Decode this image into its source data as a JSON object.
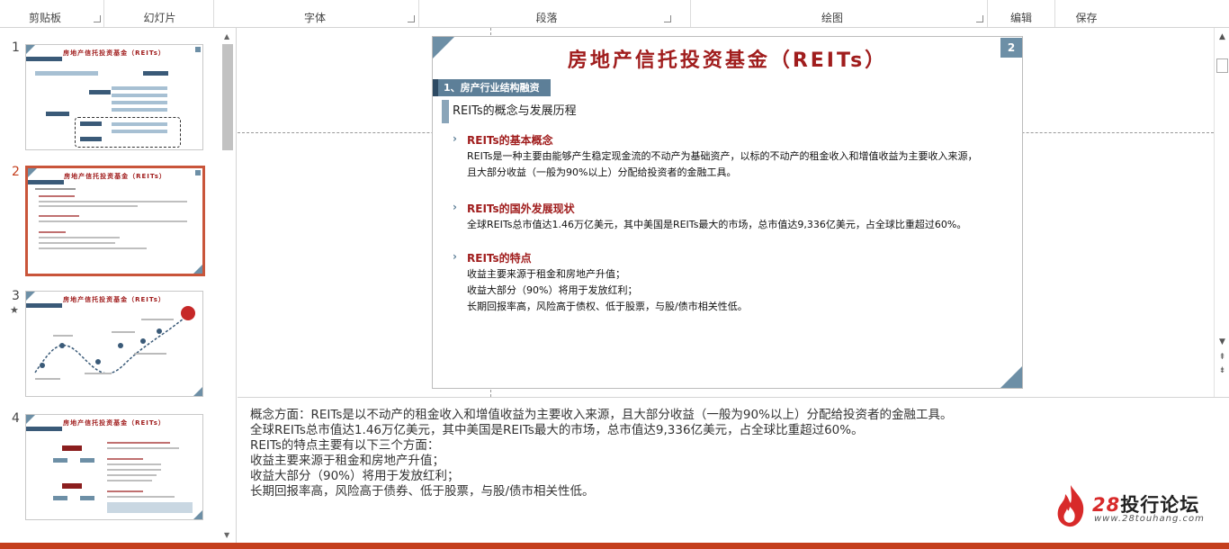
{
  "ribbon": {
    "groups": [
      {
        "label": "剪贴板"
      },
      {
        "label": "幻灯片"
      },
      {
        "label": "字体"
      },
      {
        "label": "段落"
      },
      {
        "label": "绘图"
      },
      {
        "label": "编辑"
      },
      {
        "label": "保存"
      }
    ]
  },
  "thumbnails": [
    {
      "number": "1",
      "title": "房地产信托投资基金（REITs）",
      "starred": false,
      "active": false
    },
    {
      "number": "2",
      "title": "房地产信托投资基金（REITs）",
      "starred": false,
      "active": true
    },
    {
      "number": "3",
      "title": "房地产信托投资基金（REITs）",
      "starred": true,
      "active": false
    },
    {
      "number": "4",
      "title": "房地产信托投资基金（REITs）",
      "starred": false,
      "active": false
    }
  ],
  "slide": {
    "number": "2",
    "title": "房地产信托投资基金（REITs）",
    "section": "1、房产行业结构融资",
    "subtitle": "REITs的概念与发展历程",
    "blocks": [
      {
        "heading": "REITs的基本概念",
        "lines": [
          "REITs是一种主要由能够产生稳定现金流的不动产为基础资产，以标的不动产的租金收入和增值收益为主要收入来源，",
          "且大部分收益（一般为90%以上）分配给投资者的金融工具。"
        ]
      },
      {
        "heading": "REITs的国外发展现状",
        "lines": [
          "全球REITs总市值达1.46万亿美元，其中美国是REITs最大的市场，总市值达9,336亿美元，占全球比重超过60%。"
        ]
      },
      {
        "heading": "REITs的特点",
        "lines": [
          "收益主要来源于租金和房地产升值；",
          "收益大部分（90%）将用于发放红利；",
          "长期回报率高，风险高于债权、低于股票，与股/债市相关性低。"
        ]
      }
    ]
  },
  "notes": {
    "lines": [
      "概念方面：REITs是以不动产的租金收入和增值收益为主要收入来源，且大部分收益（一般为90%以上）分配给投资者的金融工具。",
      "全球REITs总市值达1.46万亿美元，其中美国是REITs最大的市场，总市值达9,336亿美元，占全球比重超过60%。",
      "REITs的特点主要有以下三个方面：",
      "收益主要来源于租金和房地产升值；",
      "收益大部分（90%）将用于发放红利；",
      "长期回报率高，风险高于债券、低于股票，与股/债市相关性低。"
    ]
  },
  "watermark": {
    "brand_num": "28",
    "brand_text": "投行论坛",
    "url": "www.28touhang.com"
  },
  "colors": {
    "accent": "#c43e1c",
    "title_red": "#a01d1d",
    "slate": "#6d8fa6"
  }
}
